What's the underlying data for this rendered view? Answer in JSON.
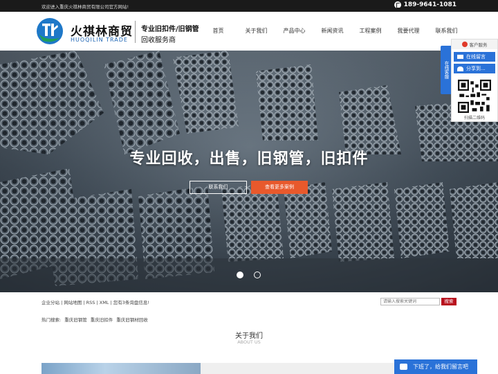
{
  "topbar": {
    "welcome": "欢迎进入重庆火祺林商贸有限公司官方网站!",
    "phone": "189-9641-1081"
  },
  "brand": {
    "name_cn": "火祺林商贸",
    "name_en": "HUOQILIN TRADE",
    "slogan_line1": "专业旧扣件/旧钢管",
    "slogan_line2": "回收服务商"
  },
  "nav": {
    "items": [
      "首页",
      "关于我们",
      "产品中心",
      "新闻资讯",
      "工程案例",
      "我要代理",
      "联系我们"
    ]
  },
  "hero": {
    "title": "专业回收，出售，旧钢管，旧扣件",
    "btn_contact": "联系我们",
    "btn_cases": "查看更多案例"
  },
  "sitelinks": {
    "text": "企业分站 | 网站地图 | RSS | XML | 您有3条询盘信息!"
  },
  "search": {
    "placeholder": "请输入搜索关键词",
    "button": "搜索"
  },
  "hot": {
    "label": "热门搜索:",
    "items": [
      "重庆旧钢管",
      "重庆旧扣件",
      "重庆旧钢材回收"
    ]
  },
  "about": {
    "title": "关于我们",
    "subtitle": "ABOUT US"
  },
  "float": {
    "header": "客户服务",
    "leave_msg": "在线留言",
    "share": "分享到...",
    "qr_label": "扫描二维码",
    "side_tab": "在线客服"
  },
  "msgbar": {
    "text": "下班了，给我们留言吧"
  },
  "colors": {
    "accent_blue": "#2a72d8",
    "accent_orange": "#e8592c",
    "accent_red": "#b8101d",
    "topbar": "#1a1a1a"
  }
}
